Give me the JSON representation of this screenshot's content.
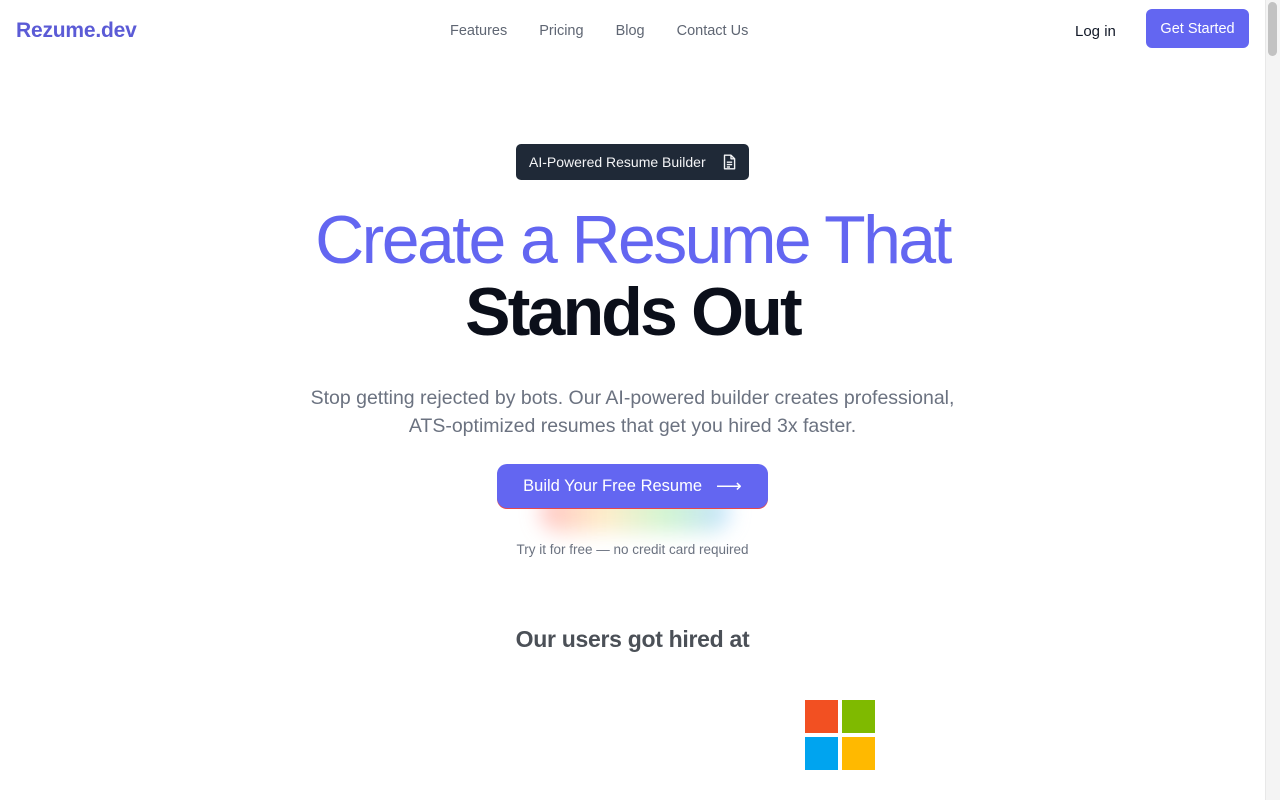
{
  "brand": {
    "name": "Rezume.dev",
    "color": "#5b5bd6"
  },
  "nav": {
    "items": [
      {
        "label": "Features"
      },
      {
        "label": "Pricing"
      },
      {
        "label": "Blog"
      },
      {
        "label": "Contact Us"
      }
    ]
  },
  "header": {
    "login_label": "Log in",
    "cta_label": "Get Started"
  },
  "hero": {
    "badge": {
      "label": "AI-Powered Resume Builder",
      "icon": "document-icon"
    },
    "headline_line1": "Create a Resume That",
    "headline_line2": "Stands Out",
    "subtitle": "Stop getting rejected by bots. Our AI-powered builder creates professional, ATS-optimized resumes that get you hired 3x faster.",
    "cta_label": "Build Your Free Resume",
    "cta_icon": "arrow-right-icon",
    "cta_note": "Try it for free — no credit card required"
  },
  "companies": {
    "title": "Our users got hired at",
    "logos": [
      {
        "name": "microsoft-logo",
        "colors": [
          "#f25022",
          "#7fba00",
          "#00a4ef",
          "#ffb900"
        ]
      }
    ]
  },
  "colors": {
    "accent": "#6366f1",
    "dark": "#1f2937"
  }
}
